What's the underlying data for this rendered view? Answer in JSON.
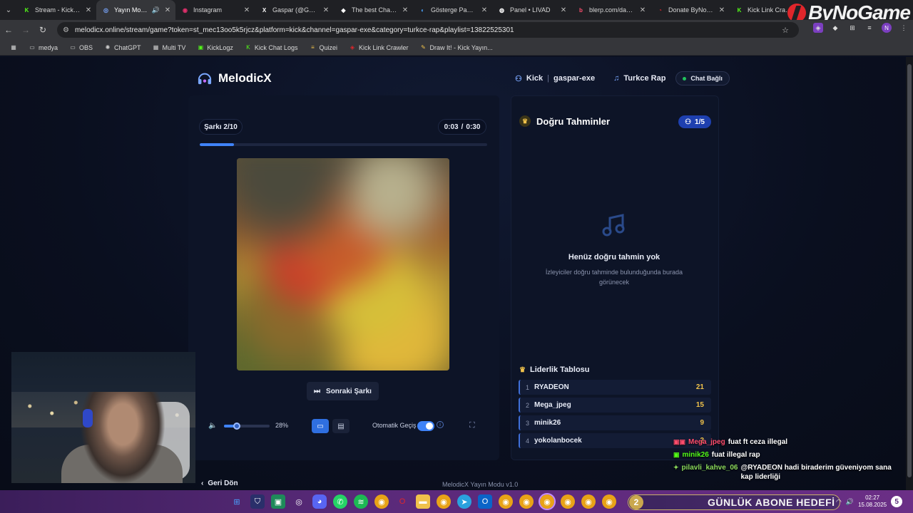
{
  "browser": {
    "tabs": [
      {
        "title": "Stream - Kick Da",
        "icon": "kick-icon",
        "color": "#53fc18",
        "glyph": "K",
        "active": false
      },
      {
        "title": "Yayın Modu",
        "icon": "melodicx-icon",
        "color": "#7aa7ff",
        "glyph": "◎",
        "active": true
      },
      {
        "title": "Instagram",
        "icon": "instagram-icon",
        "color": "#e1306c",
        "glyph": "◉",
        "active": false
      },
      {
        "title": "Gaspar (@Gaspar",
        "icon": "x-icon",
        "color": "#ffffff",
        "glyph": "X",
        "active": false
      },
      {
        "title": "The best ChatBot",
        "icon": "chatbot-icon",
        "color": "#ffffff",
        "glyph": "◆",
        "active": false
      },
      {
        "title": "Gösterge Paneli",
        "icon": "dashboard-icon",
        "color": "#4aa3ff",
        "glyph": "◐",
        "active": false
      },
      {
        "title": "Panel • LIVAD",
        "icon": "livad-icon",
        "color": "#ffffff",
        "glyph": "◍",
        "active": false
      },
      {
        "title": "blerp.com/dashb",
        "icon": "blerp-icon",
        "color": "#ff4d6d",
        "glyph": "b",
        "active": false
      },
      {
        "title": "Donate ByNoGan",
        "icon": "bynogame-icon",
        "color": "#e0262b",
        "glyph": "◔",
        "active": false
      },
      {
        "title": "Kick Link Crawle",
        "icon": "kick-icon",
        "color": "#53fc18",
        "glyph": "K",
        "active": false
      }
    ],
    "url": "melodicx.online/stream/game?token=st_mec13oo5k5rjcz&platform=kick&channel=gaspar-exe&category=turkce-rap&playlist=13822525301",
    "bookmarks": [
      {
        "label": "medya",
        "icon": "folder-icon",
        "color": "#cfcfcf",
        "glyph": "▭"
      },
      {
        "label": "OBS",
        "icon": "folder-icon",
        "color": "#cfcfcf",
        "glyph": "▭"
      },
      {
        "label": "ChatGPT",
        "icon": "chatgpt-icon",
        "color": "#cfcfcf",
        "glyph": "✺"
      },
      {
        "label": "Multi TV",
        "icon": "multitv-icon",
        "color": "#cfcfcf",
        "glyph": "▦"
      },
      {
        "label": "KickLogz",
        "icon": "kicklogz-icon",
        "color": "#53fc18",
        "glyph": "▣"
      },
      {
        "label": "Kick Chat Logs",
        "icon": "kick-icon",
        "color": "#53fc18",
        "glyph": "K"
      },
      {
        "label": "Quizei",
        "icon": "quizei-icon",
        "color": "#f0c24b",
        "glyph": "≡"
      },
      {
        "label": "Kick Link Crawler",
        "icon": "crawler-icon",
        "color": "#e0262b",
        "glyph": "◈"
      },
      {
        "label": "Draw It! - Kick Yayın...",
        "icon": "drawit-icon",
        "color": "#f0c24b",
        "glyph": "✎"
      }
    ],
    "brand_logo_text": "ByNoGame"
  },
  "app": {
    "brand": "MelodicX",
    "platform": "Kick",
    "channel": "gaspar-exe",
    "category": "Turkce Rap",
    "chat_status": "Chat Bağlı",
    "song_counter": "Şarkı 2/10",
    "time_current": "0:03",
    "time_sep": "/",
    "time_total": "0:30",
    "progress_fraction": 0.12,
    "next_button": "Sonraki Şarkı",
    "volume_percent": 28,
    "volume_label": "28%",
    "auto_pass_label": "Otomatik Geçiş",
    "back_label": "Geri Dön",
    "footer_version": "MelodicX Yayın Modu v1.0"
  },
  "guesses": {
    "title": "Doğru Tahminler",
    "count": "1/5",
    "empty_title": "Henüz doğru tahmin yok",
    "empty_desc": "İzleyiciler doğru tahminde bulunduğunda burada görünecek"
  },
  "leaderboard": {
    "title": "Liderlik Tablosu",
    "rows": [
      {
        "rank": "1",
        "name": "RYADEON",
        "points": "21"
      },
      {
        "rank": "2",
        "name": "Mega_jpeg",
        "points": "15"
      },
      {
        "rank": "3",
        "name": "minik26",
        "points": "9"
      },
      {
        "rank": "4",
        "name": "yokolanbocek",
        "points": "2"
      }
    ]
  },
  "chat": [
    {
      "user": "",
      "message": "",
      "user_color": "#ffffff",
      "faded": true
    },
    {
      "user": "Mega_jpeg",
      "message": "fuat ft ceza illegal",
      "user_color": "#ff4d6d",
      "badge": "▣▣",
      "faded": false
    },
    {
      "user": "minik26",
      "message": "fuat illegal rap",
      "user_color": "#53fc18",
      "badge": "▣",
      "faded": false
    },
    {
      "user": "pilavli_kahve_06",
      "message": "@RYADEON hadi biraderim güveniyom sana kap liderliği",
      "user_color": "#8ad85a",
      "badge": "✦",
      "faded": false
    }
  ],
  "taskbar": {
    "goal_number": "2",
    "goal_label": "GÜNLÜK ABONE HEDEFİ",
    "time": "02:27",
    "date": "15.08.2025",
    "notifications": "5"
  },
  "colors": {
    "accent": "#3f83f8",
    "gold": "#f0c24b",
    "online": "#21c35d"
  }
}
